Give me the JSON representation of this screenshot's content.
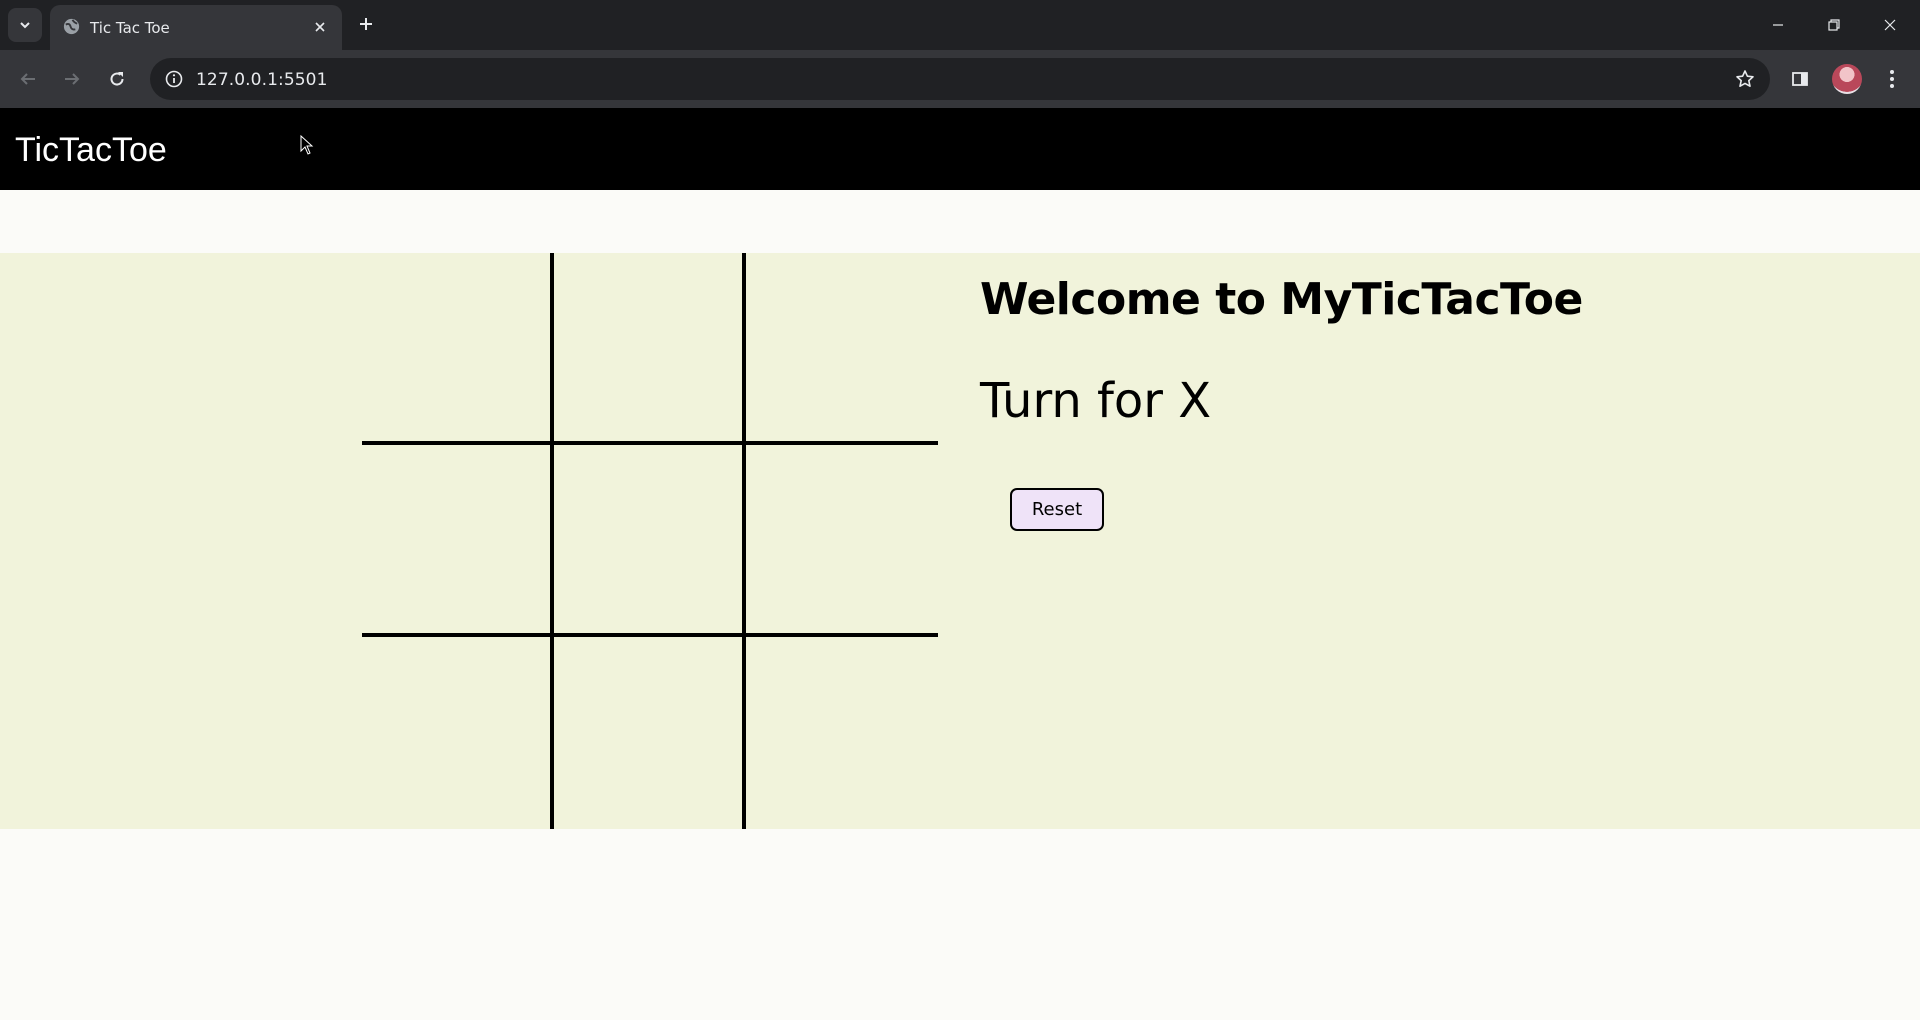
{
  "browser": {
    "tab_title": "Tic Tac Toe",
    "url": "127.0.0.1:5501",
    "icons": [
      "tab-search-icon",
      "globe-icon",
      "close-icon",
      "plus-icon",
      "minimize-icon",
      "restore-icon",
      "window-close-icon",
      "back-icon",
      "forward-icon",
      "reload-icon",
      "site-info-icon",
      "star-icon",
      "side-panel-icon",
      "avatar",
      "kebab-menu-icon"
    ]
  },
  "app": {
    "brand": "TicTacToe",
    "welcome": "Welcome to MyTicTacToe",
    "turn": "Turn for X",
    "reset_label": "Reset",
    "board": [
      "",
      "",
      "",
      "",
      "",
      "",
      "",
      "",
      ""
    ]
  },
  "colors": {
    "navbar_bg": "#000000",
    "game_bg": "#f1f3db",
    "page_bg": "#fbfbf8",
    "reset_bg": "#efe3f8"
  }
}
